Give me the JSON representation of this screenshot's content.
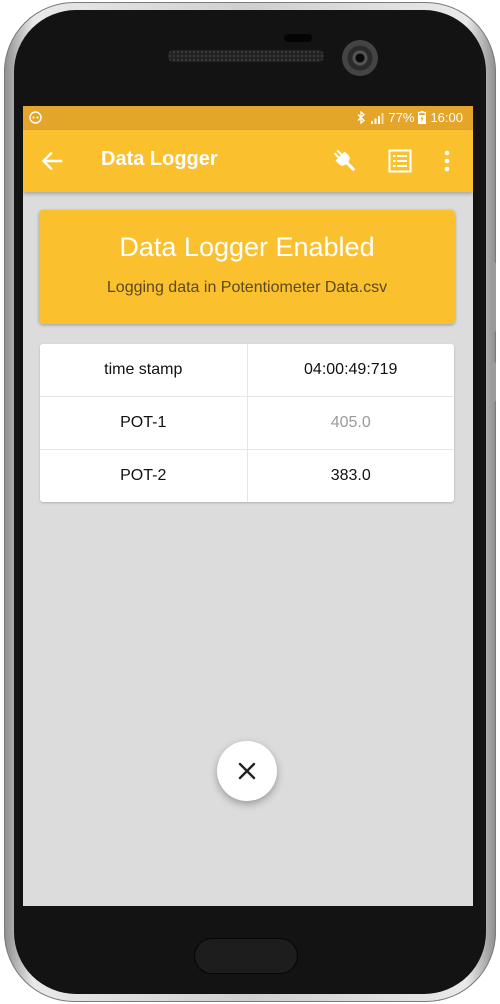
{
  "status_bar": {
    "battery": "77%",
    "time": "16:00",
    "icons": [
      "notification-icon",
      "bluetooth-icon",
      "signal-icon",
      "battery-charging-icon"
    ]
  },
  "app_bar": {
    "title": "Data Logger",
    "icons": [
      "back-arrow-icon",
      "plug-icon",
      "list-icon",
      "more-vert-icon"
    ]
  },
  "banner": {
    "title": "Data Logger Enabled",
    "subtitle": "Logging data in Potentiometer Data.csv"
  },
  "table": {
    "rows": [
      {
        "key": "time stamp",
        "value": "04:00:49:719"
      },
      {
        "key": "POT-1",
        "value": "405.0"
      },
      {
        "key": "POT-2",
        "value": "383.0"
      }
    ]
  },
  "fab": {
    "icon": "close-icon"
  },
  "colors": {
    "status_bar": "#e4a62a",
    "app_bar": "#fbc02d",
    "screen_bg": "#dcdcdc",
    "dim_value": "#9a9a9a"
  }
}
